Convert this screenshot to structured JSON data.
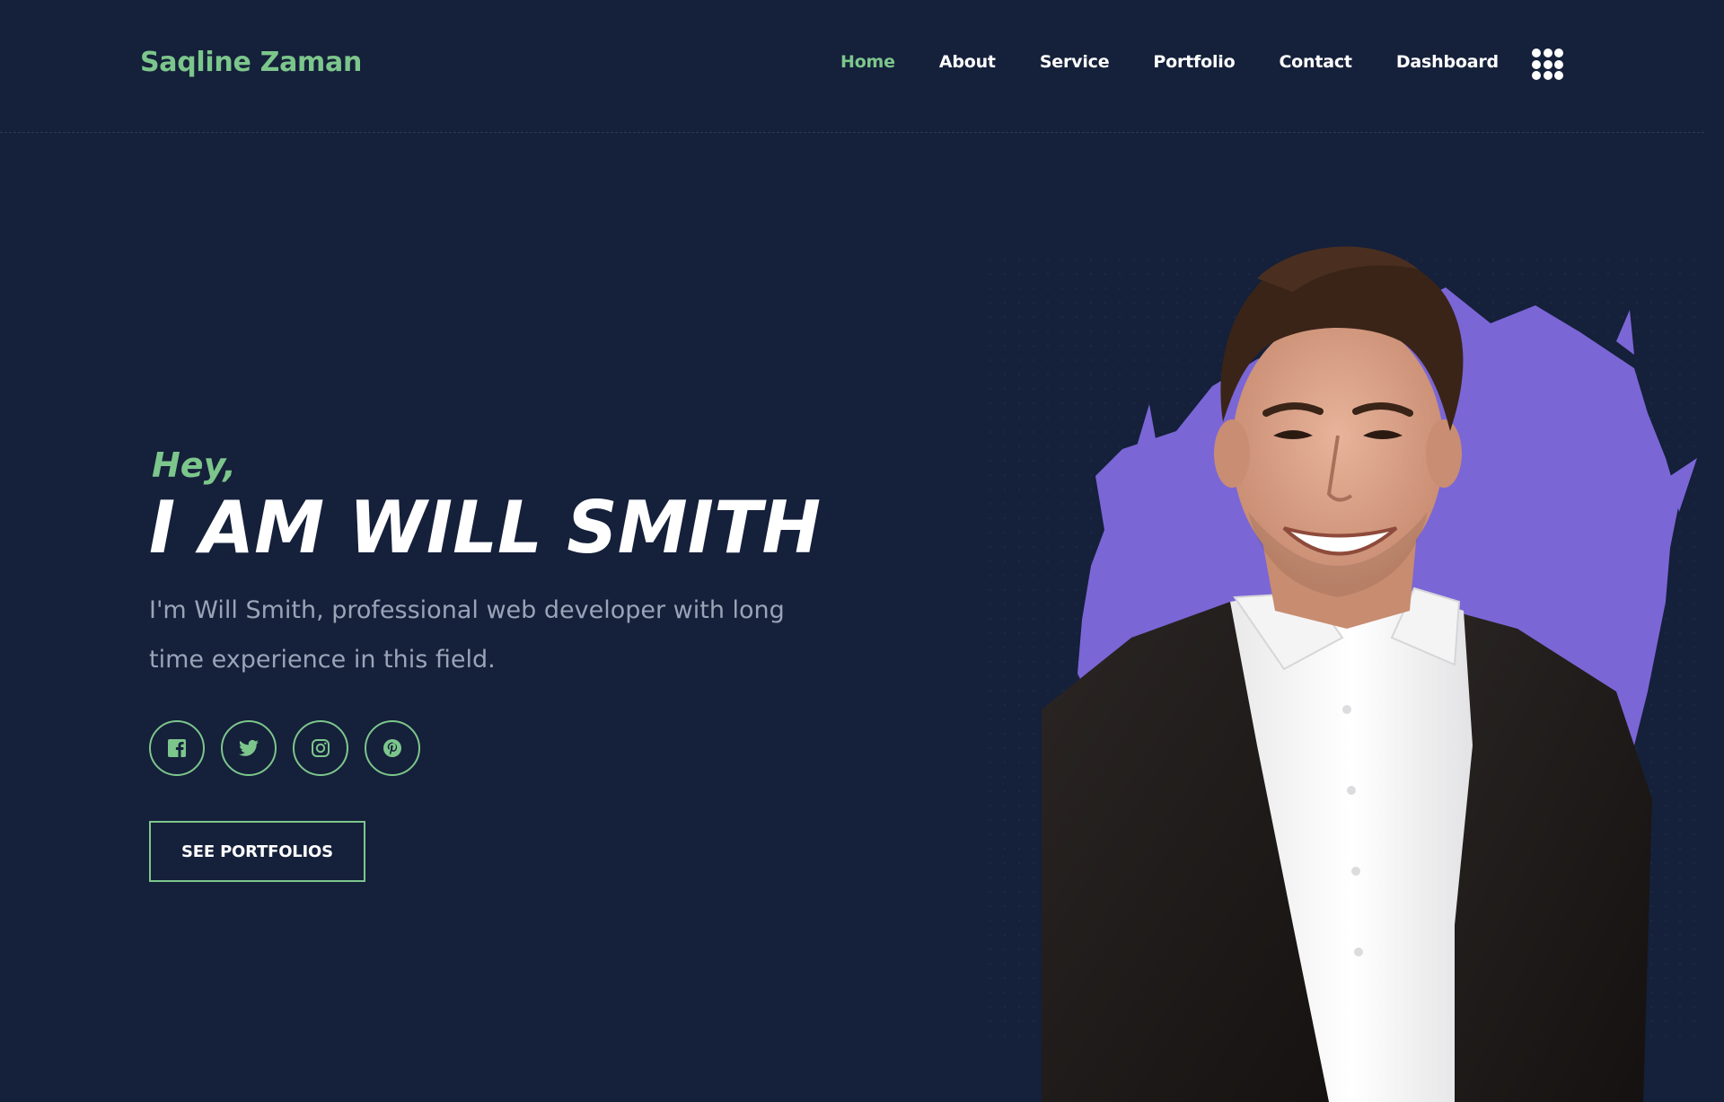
{
  "header": {
    "brand": "Saqline Zaman",
    "nav": [
      {
        "label": "Home",
        "active": true
      },
      {
        "label": "About",
        "active": false
      },
      {
        "label": "Service",
        "active": false
      },
      {
        "label": "Portfolio",
        "active": false
      },
      {
        "label": "Contact",
        "active": false
      },
      {
        "label": "Dashboard",
        "active": false
      }
    ],
    "menu_icon": "grid-menu-icon"
  },
  "hero": {
    "greeting": "Hey,",
    "headline": "I AM WILL SMITH",
    "intro": "I'm Will Smith, professional web developer with long time experience in this field.",
    "socials": [
      {
        "name": "facebook",
        "icon": "facebook-icon"
      },
      {
        "name": "twitter",
        "icon": "twitter-icon"
      },
      {
        "name": "instagram",
        "icon": "instagram-icon"
      },
      {
        "name": "pinterest",
        "icon": "pinterest-icon"
      }
    ],
    "cta_label": "SEE PORTFOLIOS",
    "image": "portrait-photo"
  },
  "colors": {
    "background": "#15203a",
    "accent": "#7cc68c",
    "splash": "#7b66d6",
    "heading": "#ffffff",
    "body_text": "#9aa4b8"
  }
}
